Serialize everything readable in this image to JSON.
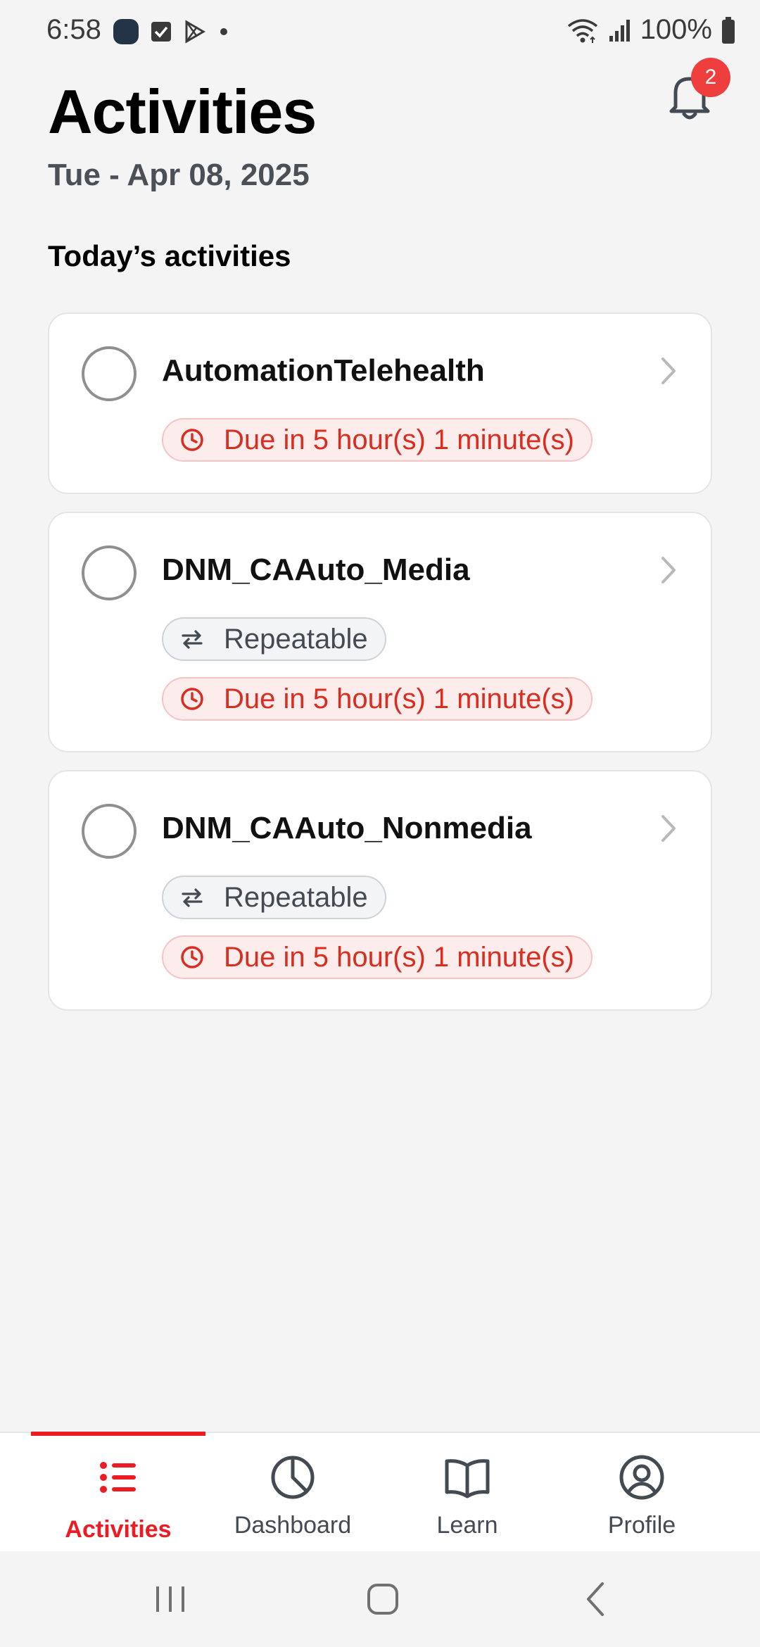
{
  "status_bar": {
    "time": "6:58",
    "battery": "100%",
    "icons": [
      "app-icon",
      "checkbox-icon",
      "play-store-icon",
      "dot-icon",
      "wifi-icon",
      "signal-icon",
      "battery-icon"
    ]
  },
  "header": {
    "title": "Activities",
    "date": "Tue - Apr 08, 2025",
    "notification_count": "2"
  },
  "section": {
    "heading": "Today’s activities"
  },
  "activities": [
    {
      "title": "AutomationTelehealth",
      "repeatable_label": "",
      "due": "Due in 5 hour(s) 1 minute(s)"
    },
    {
      "title": "DNM_CAAuto_Media",
      "repeatable_label": "Repeatable",
      "due": "Due in 5 hour(s) 1 minute(s)"
    },
    {
      "title": "DNM_CAAuto_Nonmedia",
      "repeatable_label": "Repeatable",
      "due": "Due in 5 hour(s) 1 minute(s)"
    }
  ],
  "bottom_nav": {
    "items": [
      {
        "label": "Activities",
        "icon": "list-icon",
        "active": true
      },
      {
        "label": "Dashboard",
        "icon": "pie-chart-icon",
        "active": false
      },
      {
        "label": "Learn",
        "icon": "book-icon",
        "active": false
      },
      {
        "label": "Profile",
        "icon": "user-circle-icon",
        "active": false
      }
    ]
  },
  "colors": {
    "accent": "#ec1c24",
    "due_text": "#d92d20",
    "due_bg": "#fdecec",
    "badge": "#ef3e3e",
    "background": "#f4f4f5"
  }
}
